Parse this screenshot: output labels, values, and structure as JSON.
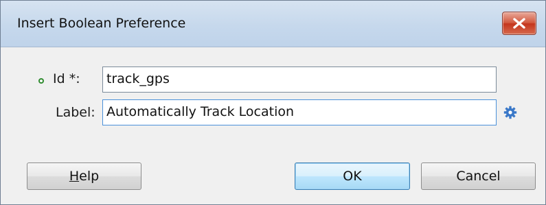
{
  "dialog": {
    "title": "Insert Boolean Preference",
    "close_icon": "close-x-icon"
  },
  "form": {
    "id_label": "Id *:",
    "id_value": "track_gps",
    "label_label": "Label:",
    "label_value": "Automatically Track Location",
    "required_indicator_icon": "required-dot-icon",
    "resource_icon": "gear-icon"
  },
  "buttons": {
    "help_mnemonic": "H",
    "help_rest": "elp",
    "ok": "OK",
    "cancel": "Cancel"
  },
  "colors": {
    "titlebar": "#c6d8ec",
    "close_button": "#c4351d",
    "required_dot": "#2f8b2f",
    "gear": "#3a78c8",
    "focus_border": "#4a90d9"
  }
}
